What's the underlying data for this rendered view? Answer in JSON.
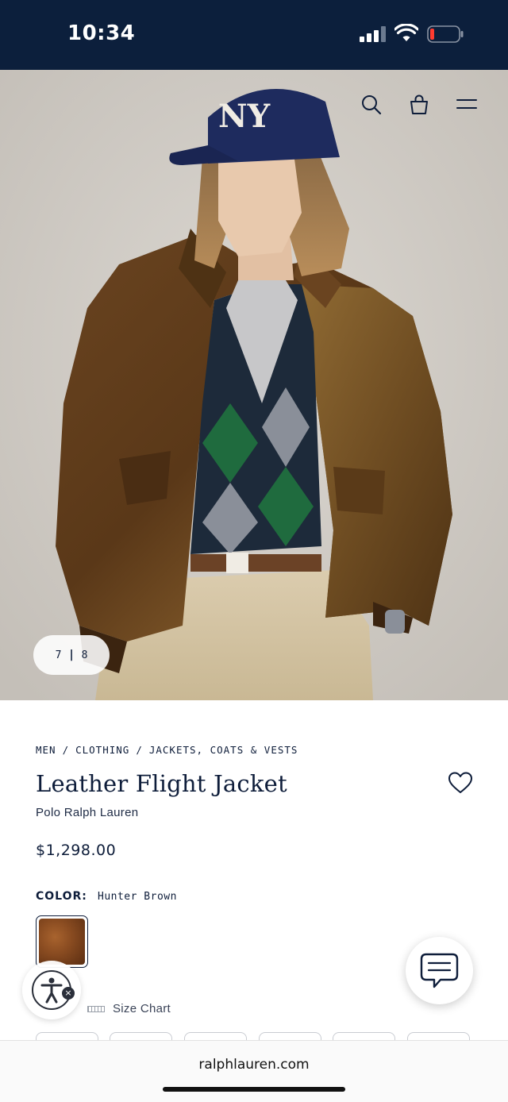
{
  "status_bar": {
    "time": "10:34"
  },
  "hero": {
    "pager": {
      "current": "7",
      "separator": "|",
      "total": "8"
    },
    "cap_text": "NY"
  },
  "header_icons": [
    "search-icon",
    "shopping-bag-icon",
    "hamburger-menu-icon"
  ],
  "breadcrumb": {
    "items": [
      "MEN",
      "CLOTHING",
      "JACKETS, COATS & VESTS"
    ],
    "separator": "/"
  },
  "product": {
    "title": "Leather Flight Jacket",
    "brand": "Polo Ralph Lauren",
    "price": "$1,298.00",
    "color_label": "COLOR:",
    "color_value": "Hunter Brown",
    "size_chart_label": "Size Chart"
  },
  "browser": {
    "url": "ralphlauren.com"
  },
  "colors": {
    "navy": "#0c1f3c",
    "text": "#0e1d3a",
    "swatch": "#8a4c21"
  }
}
